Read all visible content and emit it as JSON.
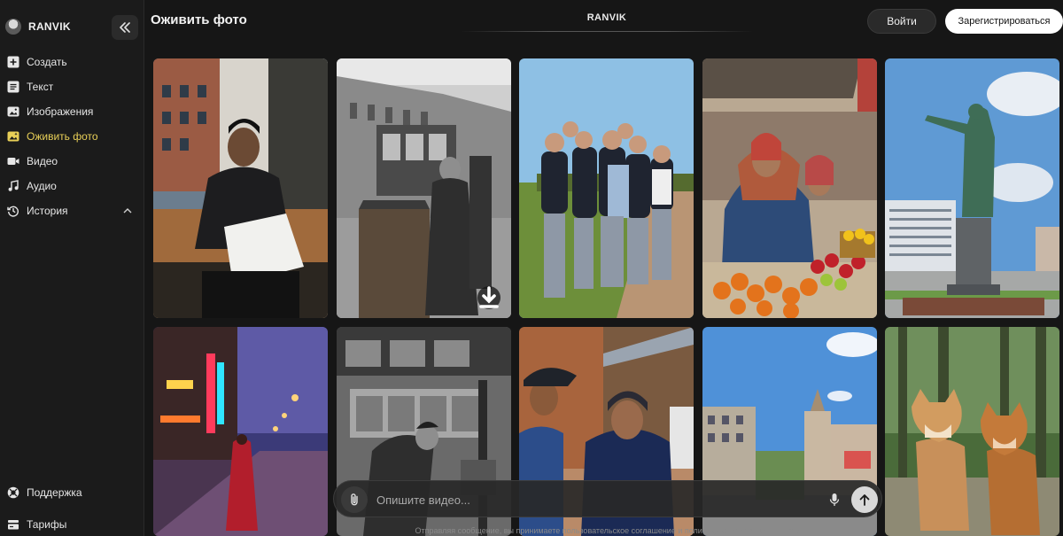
{
  "brand": {
    "name": "RANVIK"
  },
  "sidebar": {
    "items": [
      {
        "label": "Создать",
        "icon": "plus-icon"
      },
      {
        "label": "Текст",
        "icon": "text-icon"
      },
      {
        "label": "Изображения",
        "icon": "image-icon"
      },
      {
        "label": "Оживить фото",
        "icon": "animate-photo-icon",
        "active": true
      },
      {
        "label": "Видео",
        "icon": "video-icon"
      },
      {
        "label": "Аудио",
        "icon": "music-icon"
      },
      {
        "label": "История",
        "icon": "history-icon"
      }
    ],
    "bottom": [
      {
        "label": "Поддержка",
        "icon": "support-icon"
      },
      {
        "label": "Тарифы",
        "icon": "pricing-icon"
      }
    ]
  },
  "header": {
    "title": "Оживить фото",
    "center": "RANVIK",
    "login": "Войти",
    "register": "Зарегистрироваться"
  },
  "composer": {
    "placeholder": "Опишите видео...",
    "disclaimer": "Отправляя сообщение, вы принимаете пользовательское соглашение и политику конфиденциальности"
  },
  "colors": {
    "background": "#161616",
    "sidebar": "#1b1b1b",
    "active": "#e8cf57",
    "accent_button": "#ffffff"
  }
}
